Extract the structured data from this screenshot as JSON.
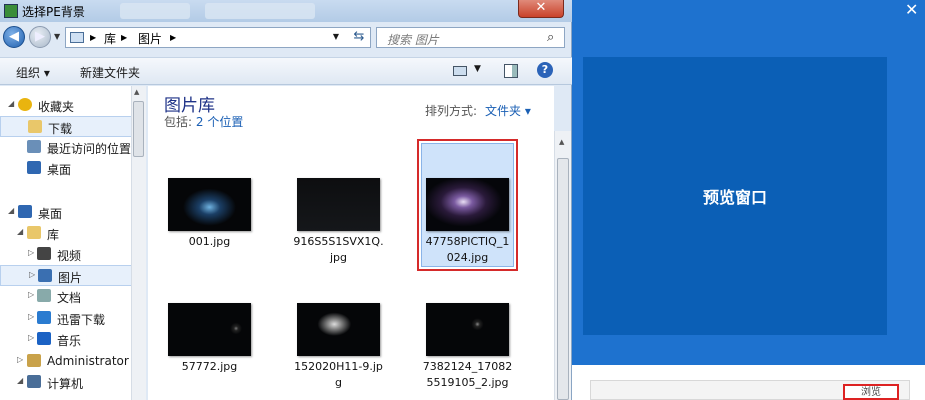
{
  "window": {
    "title": "选择PE背景",
    "close_glyph": "✕"
  },
  "nav": {
    "back_glyph": "◀",
    "forward_glyph": "▶",
    "dropdown_glyph": "▼"
  },
  "address": {
    "crumbs": [
      "库",
      "图片"
    ],
    "separator": "▶",
    "refresh_glyph": "⇆"
  },
  "search": {
    "placeholder": "搜索 图片",
    "icon": "search-icon"
  },
  "toolbar": {
    "organize": "组织 ▾",
    "new_folder": "新建文件夹",
    "help": "?"
  },
  "sidebar": {
    "items": [
      {
        "label": "收藏夹",
        "icon": "star-icon"
      },
      {
        "label": "下载",
        "icon": "download-folder-icon"
      },
      {
        "label": "最近访问的位置",
        "icon": "recent-places-icon"
      },
      {
        "label": "桌面",
        "icon": "desktop-icon"
      },
      {
        "label": "桌面",
        "icon": "desktop-icon"
      },
      {
        "label": "库",
        "icon": "library-icon"
      },
      {
        "label": "视频",
        "icon": "video-icon"
      },
      {
        "label": "图片",
        "icon": "pictures-icon"
      },
      {
        "label": "文档",
        "icon": "documents-icon"
      },
      {
        "label": "迅雷下载",
        "icon": "thunder-download-icon"
      },
      {
        "label": "音乐",
        "icon": "music-icon"
      },
      {
        "label": "Administrator",
        "icon": "user-folder-icon"
      },
      {
        "label": "计算机",
        "icon": "computer-icon"
      }
    ]
  },
  "library": {
    "title": "图片库",
    "includes_label": "包括:",
    "includes_link": "2 个位置",
    "arrange_label": "排列方式:",
    "arrange_value": "文件夹 ▾"
  },
  "files": [
    {
      "name_line1": "001.jpg",
      "name_line2": ""
    },
    {
      "name_line1": "916S5S1SVX1Q.",
      "name_line2": "jpg"
    },
    {
      "name_line1": "47758PICTIQ_1",
      "name_line2": "024.jpg"
    },
    {
      "name_line1": "57772.jpg",
      "name_line2": ""
    },
    {
      "name_line1": "152020H11-9.jp",
      "name_line2": "g"
    },
    {
      "name_line1": "7382124_17082",
      "name_line2": "5519105_2.jpg"
    }
  ],
  "right_panel": {
    "preview_label": "预览窗口",
    "browse_label": "浏览",
    "close_glyph": "✕"
  }
}
